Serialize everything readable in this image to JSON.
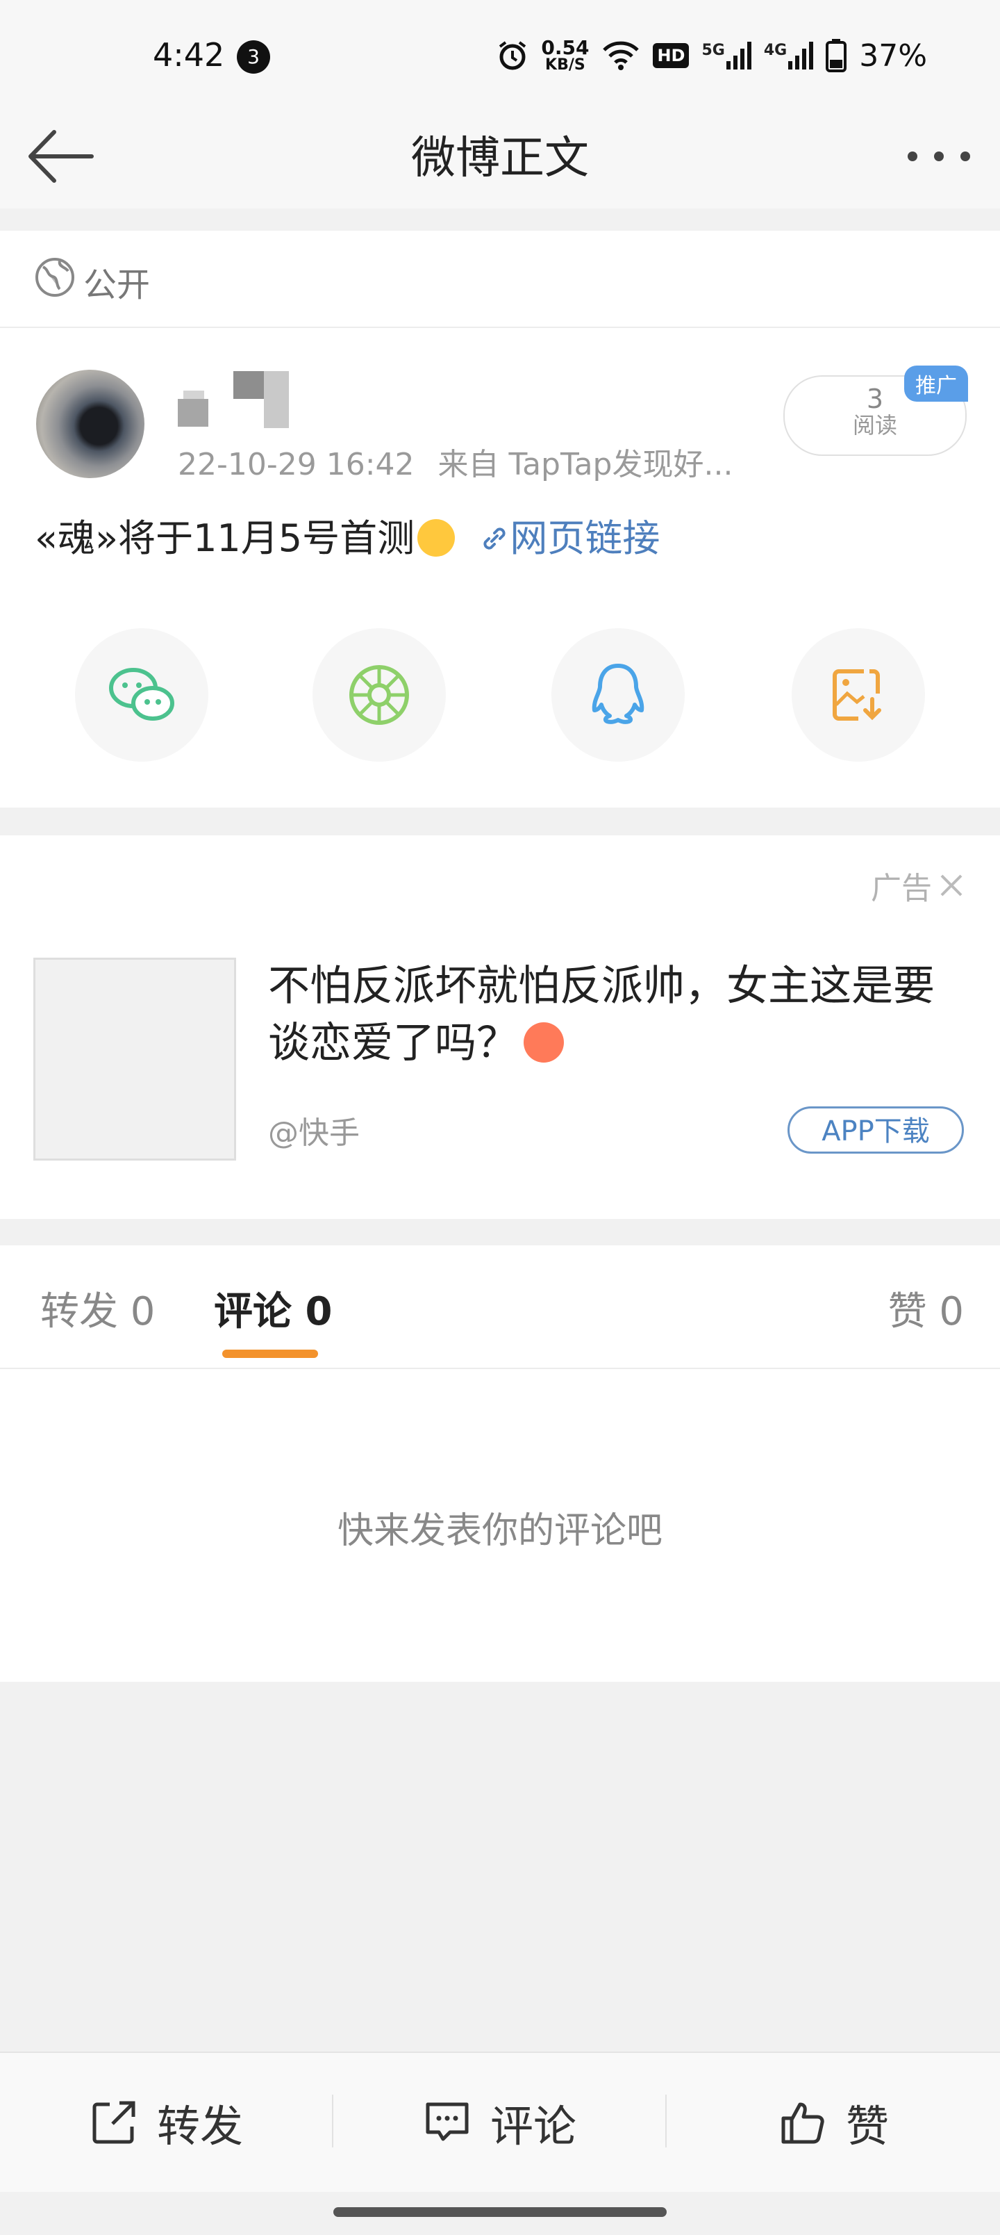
{
  "status_bar": {
    "time": "4:42",
    "notification_count": "3",
    "net_speed_value": "0.54",
    "net_speed_unit": "KB/S",
    "hd_label": "HD",
    "signal1_label": "5G",
    "signal2_label": "4G",
    "battery": "37%"
  },
  "nav": {
    "title": "微博正文"
  },
  "visibility": {
    "label": "公开"
  },
  "post": {
    "time": "22-10-29 16:42",
    "source": "来自 TapTap发现好...",
    "read_count": "3",
    "read_label": "阅读",
    "promo_badge": "推广",
    "text": "«魂»将于11月5号首测",
    "link_text": "网页链接"
  },
  "share_icons": [
    "wechat-icon",
    "moments-icon",
    "qq-icon",
    "save-image-icon"
  ],
  "ad": {
    "label": "广告",
    "title": "不怕反派坏就怕反派帅，女主这是要谈恋爱了吗？",
    "source": "@快手",
    "button": "APP下载"
  },
  "tabs": {
    "repost": "转发 0",
    "comment": "评论 0",
    "like": "赞 0"
  },
  "comments": {
    "empty_text": "快来发表你的评论吧"
  },
  "actions": {
    "repost": "转发",
    "comment": "评论",
    "like": "赞"
  },
  "colors": {
    "accent": "#f3922c",
    "link": "#4e7fbd",
    "promo": "#5a9ee8"
  }
}
